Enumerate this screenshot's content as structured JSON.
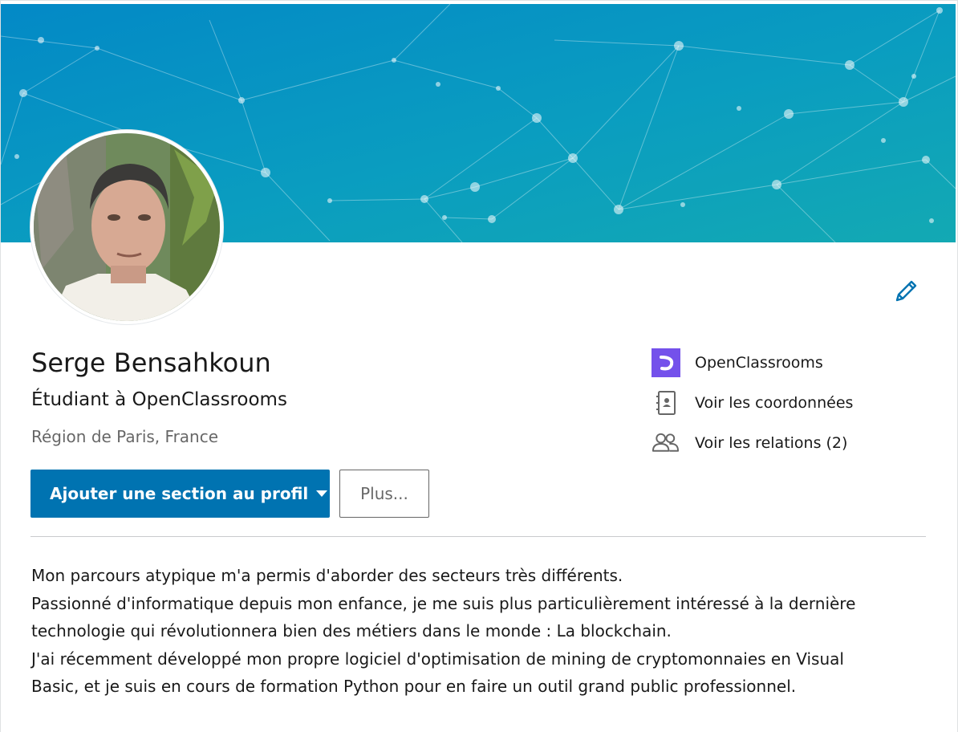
{
  "profile": {
    "name": "Serge Bensahkoun",
    "headline": "Étudiant à OpenClassrooms",
    "location": "Région de Paris, France"
  },
  "actions": {
    "add_section_label": "Ajouter une section au profil",
    "more_label": "Plus..."
  },
  "sidebar": {
    "items": [
      {
        "label": "OpenClassrooms",
        "icon": "openclassrooms-logo-icon"
      },
      {
        "label": "Voir les coordonnées",
        "icon": "contact-book-icon"
      },
      {
        "label": "Voir les relations (2)",
        "icon": "people-icon"
      }
    ]
  },
  "summary": {
    "lines": [
      "Mon parcours atypique m'a permis d'aborder des secteurs très différents.",
      "Passionné d'informatique depuis mon enfance, je me suis plus particulièrement intéressé à la dernière",
      "technologie qui révolutionnera bien des métiers dans le monde : La blockchain.",
      "J'ai récemment développé mon propre logiciel d'optimisation de mining de cryptomonnaies en Visual",
      "Basic, et je suis en cours de formation Python pour en faire un outil grand public professionnel."
    ]
  },
  "colors": {
    "primary": "#0073b1",
    "banner_start": "#0391c8",
    "banner_end": "#10a6b5",
    "openclassrooms": "#7451eb"
  }
}
